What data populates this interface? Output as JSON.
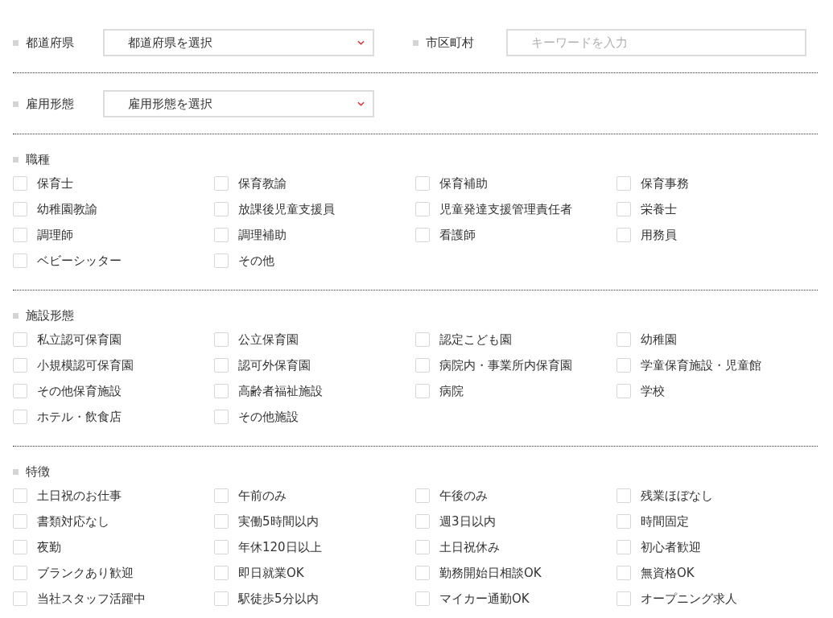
{
  "filters": [
    {
      "label": "都道府県",
      "kind": "select",
      "value": "都道府県を選択"
    },
    {
      "label": "市区町村",
      "kind": "input",
      "placeholder": "キーワードを入力"
    },
    {
      "label": "雇用形態",
      "kind": "select",
      "value": "雇用形態を選択"
    }
  ],
  "groups": [
    {
      "title": "職種",
      "options": [
        {
          "label": "保育士",
          "checked": false
        },
        {
          "label": "保育教諭",
          "checked": false
        },
        {
          "label": "保育補助",
          "checked": false
        },
        {
          "label": "保育事務",
          "checked": false
        },
        {
          "label": "幼稚園教諭",
          "checked": false
        },
        {
          "label": "放課後児童支援員",
          "checked": false
        },
        {
          "label": "児童発達支援管理責任者",
          "checked": false
        },
        {
          "label": "栄養士",
          "checked": false
        },
        {
          "label": "調理師",
          "checked": false
        },
        {
          "label": "調理補助",
          "checked": false
        },
        {
          "label": "看護師",
          "checked": false
        },
        {
          "label": "用務員",
          "checked": false
        },
        {
          "label": "ベビーシッター",
          "checked": false
        },
        {
          "label": "その他",
          "checked": false
        }
      ]
    },
    {
      "title": "施設形態",
      "options": [
        {
          "label": "私立認可保育園",
          "checked": false
        },
        {
          "label": "公立保育園",
          "checked": false
        },
        {
          "label": "認定こども園",
          "checked": false
        },
        {
          "label": "幼稚園",
          "checked": false
        },
        {
          "label": "小規模認可保育園",
          "checked": false
        },
        {
          "label": "認可外保育園",
          "checked": false
        },
        {
          "label": "病院内・事業所内保育園",
          "checked": false
        },
        {
          "label": "学童保育施設・児童館",
          "checked": false
        },
        {
          "label": "その他保育施設",
          "checked": false
        },
        {
          "label": "高齢者福祉施設",
          "checked": false
        },
        {
          "label": "病院",
          "checked": false
        },
        {
          "label": "学校",
          "checked": false
        },
        {
          "label": "ホテル・飲食店",
          "checked": false
        },
        {
          "label": "その他施設",
          "checked": false
        }
      ]
    },
    {
      "title": "特徴",
      "options": [
        {
          "label": "土日祝のお仕事",
          "checked": false
        },
        {
          "label": "午前のみ",
          "checked": false
        },
        {
          "label": "午後のみ",
          "checked": false
        },
        {
          "label": "残業ほぼなし",
          "checked": false
        },
        {
          "label": "書類対応なし",
          "checked": false
        },
        {
          "label": "実働5時間以内",
          "checked": false
        },
        {
          "label": "週3日以内",
          "checked": false
        },
        {
          "label": "時間固定",
          "checked": false
        },
        {
          "label": "夜勤",
          "checked": false
        },
        {
          "label": "年休120日以上",
          "checked": false
        },
        {
          "label": "土日祝休み",
          "checked": false
        },
        {
          "label": "初心者歓迎",
          "checked": false
        },
        {
          "label": "ブランクあり歓迎",
          "checked": false
        },
        {
          "label": "即日就業OK",
          "checked": false
        },
        {
          "label": "勤務開始日相談OK",
          "checked": false
        },
        {
          "label": "無資格OK",
          "checked": false
        },
        {
          "label": "当社スタッフ活躍中",
          "checked": false
        },
        {
          "label": "駅徒歩5分以内",
          "checked": false
        },
        {
          "label": "マイカー通勤OK",
          "checked": false
        },
        {
          "label": "オープニング求人",
          "checked": false
        }
      ]
    }
  ]
}
